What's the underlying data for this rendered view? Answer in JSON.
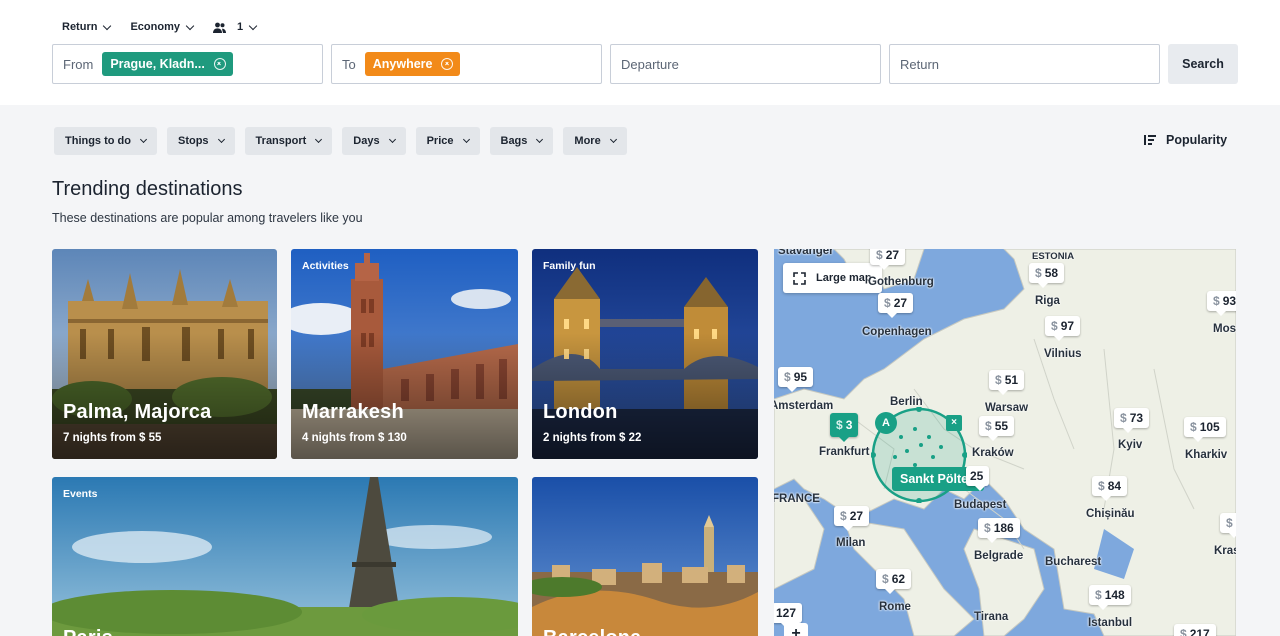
{
  "header": {
    "trip_type": "Return",
    "cabin": "Economy",
    "passengers": "1",
    "from_label": "From",
    "from_value": "Prague, Kladn...",
    "to_label": "To",
    "to_value": "Anywhere",
    "departure_placeholder": "Departure",
    "return_placeholder": "Return",
    "search_label": "Search",
    "colors": {
      "from_chip": "#1f9a7e",
      "to_chip": "#f28a19"
    }
  },
  "filters": [
    "Things to do",
    "Stops",
    "Transport",
    "Days",
    "Price",
    "Bags",
    "More"
  ],
  "sort": {
    "label": "Popularity",
    "icon": "sort-icon"
  },
  "section": {
    "title": "Trending destinations",
    "subtitle": "These destinations are popular among travelers like you"
  },
  "cards": [
    {
      "tag": "",
      "name": "Palma, Majorca",
      "price": "7 nights from $ 55"
    },
    {
      "tag": "Activities",
      "name": "Marrakesh",
      "price": "4 nights from $ 130"
    },
    {
      "tag": "Family fun",
      "name": "London",
      "price": "2 nights from $ 22"
    },
    {
      "tag": "Events",
      "name": "Paris",
      "price": ""
    },
    {
      "tag": "",
      "name": "Barcelona",
      "price": ""
    }
  ],
  "map": {
    "large_map_label": "Large map",
    "zoom_in": "+",
    "home_marker": "A",
    "origin_label": "Sankt Pölten",
    "cities": [
      "ESTONIA",
      "Stavanger",
      "Gothenburg",
      "Copenhagen",
      "Riga",
      "Moscow",
      "Vilnius",
      "Amsterdam",
      "Berlin",
      "Warsaw",
      "Frankfurt",
      "Kraków",
      "Kyiv",
      "Kharkiv",
      "FRANCE",
      "Budapest",
      "Chișinău",
      "Milan",
      "Belgrade",
      "Bucharest",
      "Krasnodar",
      "Rome",
      "Tirana",
      "Istanbul"
    ],
    "prices": [
      {
        "currency": "$",
        "value": "27"
      },
      {
        "currency": "$",
        "value": "27"
      },
      {
        "currency": "$",
        "value": "58"
      },
      {
        "currency": "$",
        "value": "93"
      },
      {
        "currency": "$",
        "value": "97"
      },
      {
        "currency": "$",
        "value": "95"
      },
      {
        "currency": "$",
        "value": "51"
      },
      {
        "currency": "$",
        "value": "3"
      },
      {
        "currency": "$",
        "value": "55"
      },
      {
        "currency": "$",
        "value": "73"
      },
      {
        "currency": "$",
        "value": "105"
      },
      {
        "currency": "$",
        "value": "25"
      },
      {
        "currency": "$",
        "value": "84"
      },
      {
        "currency": "$",
        "value": "27"
      },
      {
        "currency": "$",
        "value": "186"
      },
      {
        "currency": "$",
        "value": "62"
      },
      {
        "currency": "$",
        "value": "148"
      },
      {
        "currency": "$",
        "value": "127"
      },
      {
        "currency": "$",
        "value": "217"
      },
      {
        "currency": "$",
        "value": ""
      }
    ]
  }
}
